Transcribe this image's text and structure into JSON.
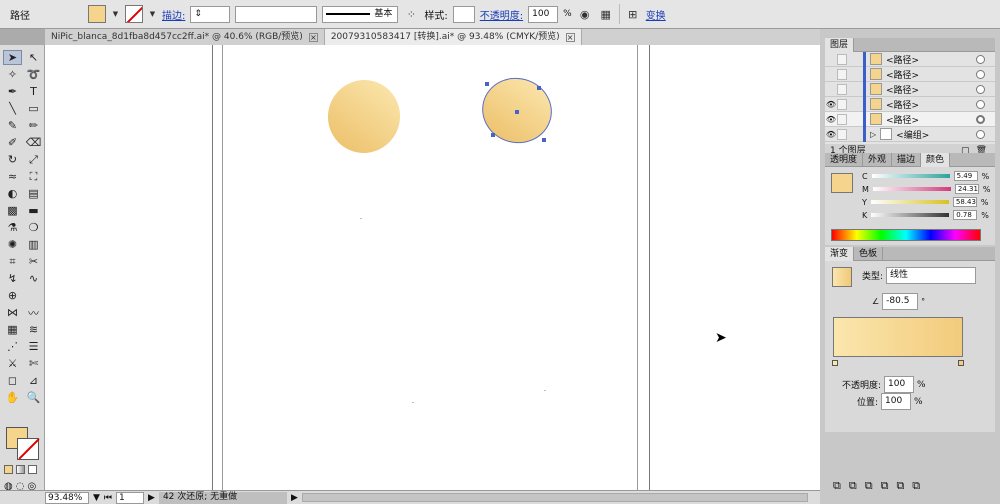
{
  "toolbar": {
    "object_type": "路径",
    "stroke_label": "描边:",
    "stroke_profile": "基本",
    "style_label": "样式:",
    "opacity_label": "不透明度:",
    "opacity_value": "100",
    "percent": "%",
    "transform_label": "变换",
    "fill_color": "#f5d58d"
  },
  "tabs": [
    {
      "label": "NiPic_blanca_8d1fba8d457cc2ff.ai* @ 40.6% (RGB/预览)"
    },
    {
      "label": "20079310583417  [转换].ai* @ 93.48% (CMYK/预览)"
    }
  ],
  "status": {
    "zoom": "93.48%",
    "page": "1",
    "history": "42 次还原; 无重做"
  },
  "layers_panel": {
    "title": "图层",
    "rows": [
      {
        "name": "<路径>"
      },
      {
        "name": "<路径>"
      },
      {
        "name": "<路径>"
      },
      {
        "name": "<路径>"
      },
      {
        "name": "<路径>"
      },
      {
        "name": "<编组>"
      }
    ],
    "footer": "1 个图层"
  },
  "color_panel": {
    "tabs": [
      "透明度",
      "外观",
      "描边",
      "颜色"
    ],
    "rows": [
      {
        "label": "C",
        "value": "5.49",
        "color": "#2ea3a0"
      },
      {
        "label": "M",
        "value": "24.31",
        "color": "#d13b7c"
      },
      {
        "label": "Y",
        "value": "58.43",
        "color": "#d8c21f"
      },
      {
        "label": "K",
        "value": "0.78",
        "color": "#333333"
      }
    ],
    "percent": "%"
  },
  "gradient_panel": {
    "tabs": [
      "渐变",
      "色板"
    ],
    "type_label": "类型:",
    "type_value": "线性",
    "angle": "-80.5",
    "degree": "°",
    "opacity_label": "不透明度:",
    "opacity_value": "100",
    "position_label": "位置:",
    "position_value": "100",
    "percent": "%"
  }
}
